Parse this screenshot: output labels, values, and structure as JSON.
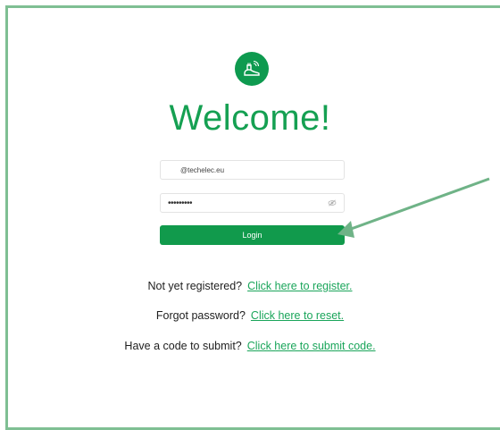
{
  "brand": {
    "logo_icon": "ev-plug-icon",
    "accent_color": "#15a052",
    "frame_color": "#7fbf93"
  },
  "header": {
    "title": "Welcome!"
  },
  "form": {
    "email_value": "@techelec.eu",
    "password_value": "•••••••••",
    "password_toggle_icon": "eye-slash-icon",
    "login_label": "Login"
  },
  "links": {
    "register_prompt": "Not yet registered?",
    "register_link": "Click here to register.",
    "reset_prompt": "Forgot password?",
    "reset_link": "Click here to reset.",
    "code_prompt": "Have a code to submit?",
    "code_link": "Click here to submit code."
  },
  "annotation": {
    "arrow_icon": "annotation-arrow-icon"
  }
}
